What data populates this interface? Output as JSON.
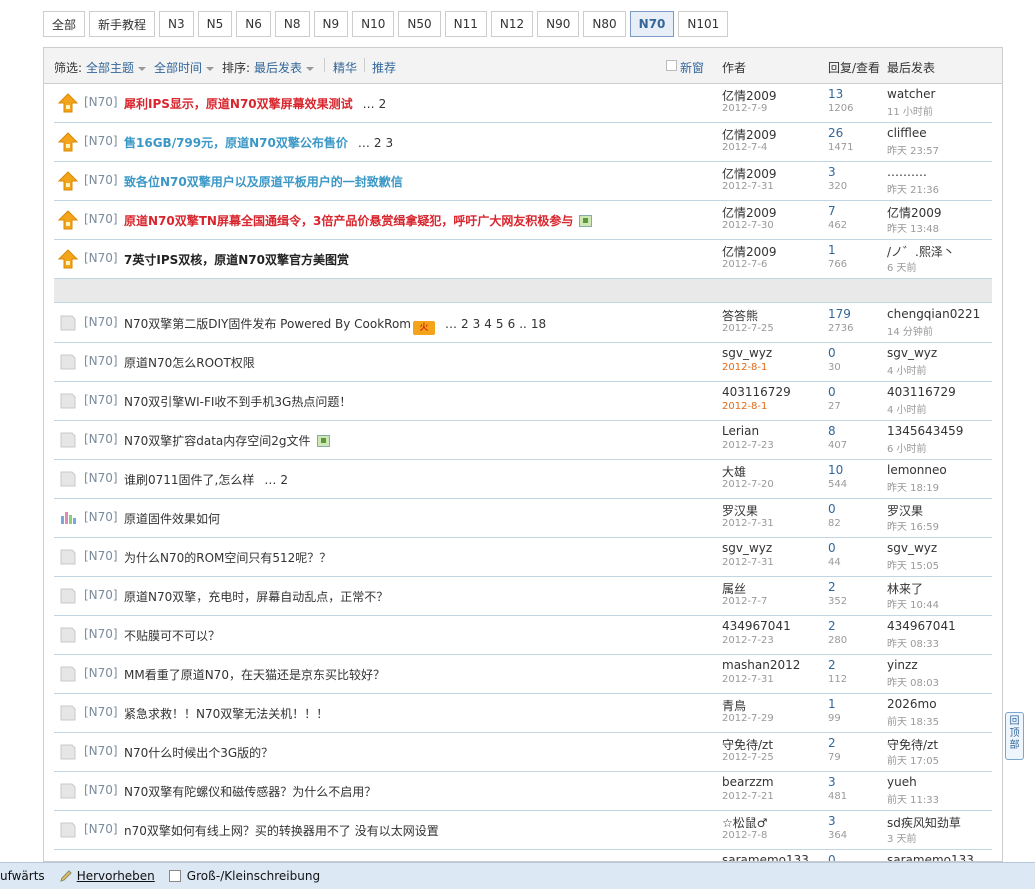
{
  "tabs": [
    "全部",
    "新手教程",
    "N3",
    "N5",
    "N6",
    "N8",
    "N9",
    "N10",
    "N50",
    "N11",
    "N12",
    "N90",
    "N80",
    "N70",
    "N101"
  ],
  "active_tab": "N70",
  "header": {
    "filter_label": "筛选:",
    "filter_topic": "全部主题",
    "filter_time": "全部时间",
    "sort_label": "排序:",
    "sort_value": "最后发表",
    "digest": "精华",
    "recommend": "推荐",
    "new_window": "新窗",
    "col_author": "作者",
    "col_reply": "回复/查看",
    "col_last": "最后发表"
  },
  "pinned_threads": [
    {
      "fid": "[N70]",
      "title": "犀利IPS显示，原道N70双擎屏幕效果测试",
      "style": "t-red",
      "pages": [
        "…",
        "2"
      ],
      "author": "亿情2009",
      "date": "2012-7-9",
      "replies": "13",
      "views": "1206",
      "last_user": "watcher",
      "last_time": "11 小时前"
    },
    {
      "fid": "[N70]",
      "title": "售16GB/799元，原道N70双擎公布售价",
      "style": "t-blue",
      "pages": [
        "…",
        "2",
        "3"
      ],
      "author": "亿情2009",
      "date": "2012-7-4",
      "replies": "26",
      "views": "1471",
      "last_user": "clifflee",
      "last_time": "昨天 23:57"
    },
    {
      "fid": "[N70]",
      "title": "致各位N70双擎用户以及原道平板用户的一封致歉信",
      "style": "t-blue",
      "pages": [],
      "author": "亿情2009",
      "date": "2012-7-31",
      "replies": "3",
      "views": "320",
      "last_user": "……….",
      "last_time": "昨天 21:36"
    },
    {
      "fid": "[N70]",
      "title": "原道N70双擎TN屏幕全国通缉令，3倍产品价悬赏缉拿疑犯，呼吁广大网友积极参与",
      "style": "t-red",
      "pages": [],
      "img": true,
      "author": "亿情2009",
      "date": "2012-7-30",
      "replies": "7",
      "views": "462",
      "last_user": "亿情2009",
      "last_time": "昨天 13:48"
    },
    {
      "fid": "[N70]",
      "title": "7英寸IPS双核，原道N70双擎官方美图赏",
      "style": "t-black",
      "pages": [],
      "author": "亿情2009",
      "date": "2012-7-6",
      "replies": "1",
      "views": "766",
      "last_user": "/ノ゛.熙泽丶",
      "last_time": "6 天前"
    }
  ],
  "threads": [
    {
      "fid": "[N70]",
      "title": "N70双擎第二版DIY固件发布 Powered By CookRom",
      "fire": "火",
      "pages": [
        "…",
        "2",
        "3",
        "4",
        "5",
        "6",
        "..",
        "18"
      ],
      "author": "答答熊",
      "date": "2012-7-25",
      "replies": "179",
      "views": "2736",
      "last_user": "chengqian0221",
      "last_time": "14 分钟前"
    },
    {
      "fid": "[N70]",
      "title": "原道N70怎么ROOT权限",
      "pages": [],
      "author": "sgv_wyz",
      "date": "2012-8-1",
      "date_new": true,
      "replies": "0",
      "views": "30",
      "last_user": "sgv_wyz",
      "last_time": "4 小时前"
    },
    {
      "fid": "[N70]",
      "title": "N70双引擎WI-FI收不到手机3G热点问题！",
      "pages": [],
      "author": "403116729",
      "date": "2012-8-1",
      "date_new": true,
      "replies": "0",
      "views": "27",
      "last_user": "403116729",
      "last_time": "4 小时前"
    },
    {
      "fid": "[N70]",
      "title": "N70双擎扩容data内存空间2g文件",
      "img": true,
      "pages": [],
      "author": "Lerian",
      "date": "2012-7-23",
      "replies": "8",
      "views": "407",
      "last_user": "1345643459",
      "last_time": "6 小时前"
    },
    {
      "fid": "[N70]",
      "title": "谁刷0711固件了,怎么样",
      "pages": [
        "…",
        "2"
      ],
      "author": "大雄",
      "date": "2012-7-20",
      "replies": "10",
      "views": "544",
      "last_user": "lemonneo",
      "last_time": "昨天 18:19"
    },
    {
      "fid": "[N70]",
      "title": "原道固件效果如何",
      "poll": true,
      "pages": [],
      "author": "罗汉果",
      "date": "2012-7-31",
      "replies": "0",
      "views": "82",
      "last_user": "罗汉果",
      "last_time": "昨天 16:59"
    },
    {
      "fid": "[N70]",
      "title": "为什么N70的ROM空间只有512呢？？",
      "pages": [],
      "author": "sgv_wyz",
      "date": "2012-7-31",
      "replies": "0",
      "views": "44",
      "last_user": "sgv_wyz",
      "last_time": "昨天 15:05"
    },
    {
      "fid": "[N70]",
      "title": "原道N70双擎，充电时，屏幕自动乱点，正常不？",
      "pages": [],
      "author": "属丝",
      "date": "2012-7-7",
      "replies": "2",
      "views": "352",
      "last_user": "林来了",
      "last_time": "昨天 10:44"
    },
    {
      "fid": "[N70]",
      "title": "不贴膜可不可以？",
      "pages": [],
      "author": "434967041",
      "date": "2012-7-23",
      "replies": "2",
      "views": "280",
      "last_user": "434967041",
      "last_time": "昨天 08:33"
    },
    {
      "fid": "[N70]",
      "title": "MM看重了原道N70，在天猫还是京东买比较好？",
      "pages": [],
      "author": "mashan2012",
      "date": "2012-7-31",
      "replies": "2",
      "views": "112",
      "last_user": "yinzz",
      "last_time": "昨天 08:03"
    },
    {
      "fid": "[N70]",
      "title": "紧急求救！！N70双擎无法关机！！！",
      "pages": [],
      "author": "青鳥",
      "date": "2012-7-29",
      "replies": "1",
      "views": "99",
      "last_user": "2026mo",
      "last_time": "前天 18:35"
    },
    {
      "fid": "[N70]",
      "title": "N70什么时候出个3G版的？",
      "pages": [],
      "author": "守免待/zt",
      "date": "2012-7-25",
      "replies": "2",
      "views": "79",
      "last_user": "守免待/zt",
      "last_time": "前天 17:05"
    },
    {
      "fid": "[N70]",
      "title": "N70双擎有陀螺仪和磁传感器？为什么不启用？",
      "pages": [],
      "author": "bearzzm",
      "date": "2012-7-21",
      "replies": "3",
      "views": "481",
      "last_user": "yueh",
      "last_time": "前天 11:33"
    },
    {
      "fid": "[N70]",
      "title": "n70双擎如何有线上网？买的转换器用不了 没有以太网设置",
      "pages": [],
      "author": "☆松鼠♂",
      "date": "2012-7-8",
      "replies": "3",
      "views": "364",
      "last_user": "sd疾风知劲草",
      "last_time": "3 天前"
    }
  ],
  "partial_row": {
    "author": "saramemo133",
    "replies": "0",
    "last_user": "saramemo133"
  },
  "back_to_top": "回顶部",
  "findbar": {
    "up": "ufwärts",
    "highlight": "Hervorheben",
    "case": "Groß-/Kleinschreibung"
  },
  "colors": {
    "accent": "#336699",
    "red": "#d8262e",
    "blue_title": "#3b98c6",
    "pin": "#f3a41b"
  }
}
